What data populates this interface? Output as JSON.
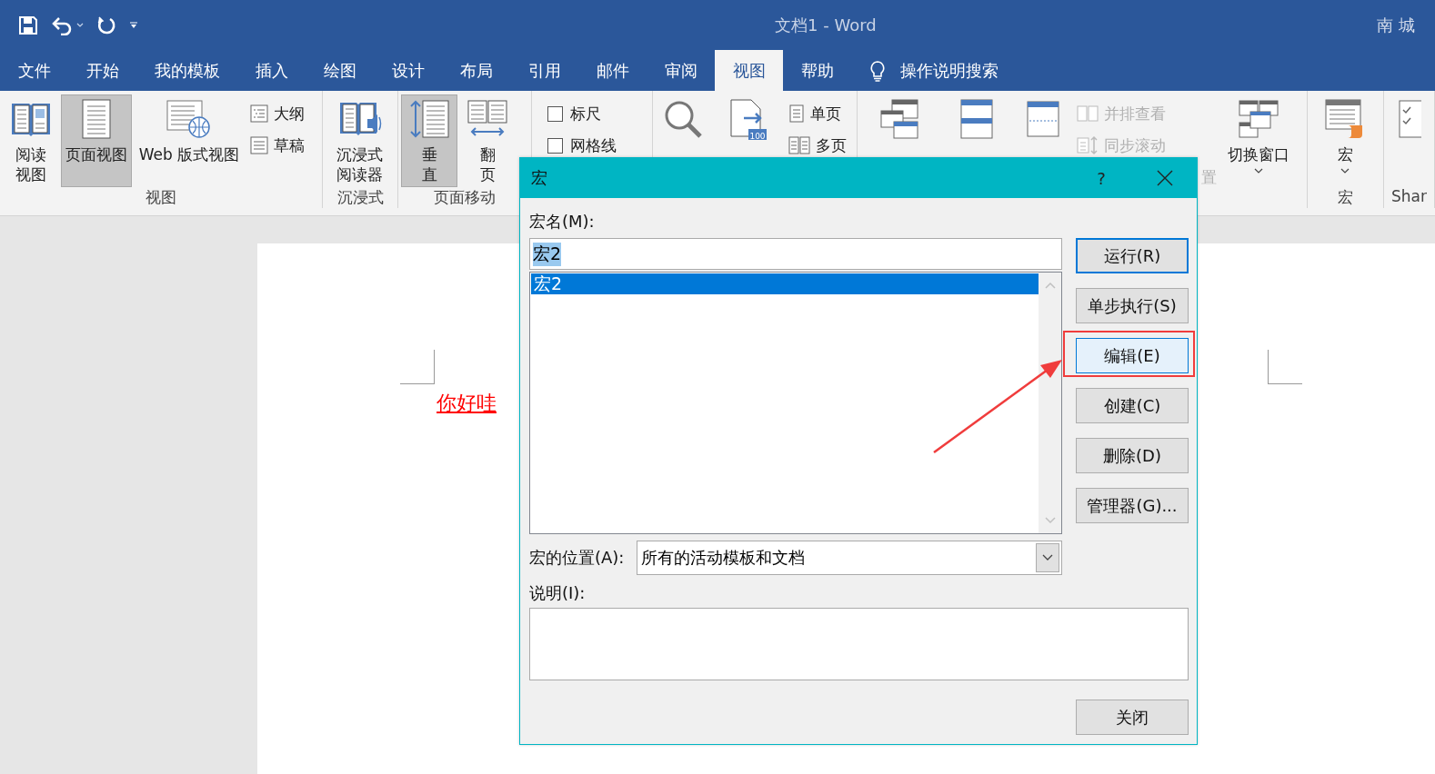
{
  "title_bar": {
    "title": "文档1 - Word",
    "user": "南 城"
  },
  "tabs": [
    {
      "label": "文件",
      "selected": false
    },
    {
      "label": "开始",
      "selected": false
    },
    {
      "label": "我的模板",
      "selected": false
    },
    {
      "label": "插入",
      "selected": false
    },
    {
      "label": "绘图",
      "selected": false
    },
    {
      "label": "设计",
      "selected": false
    },
    {
      "label": "布局",
      "selected": false
    },
    {
      "label": "引用",
      "selected": false
    },
    {
      "label": "邮件",
      "selected": false
    },
    {
      "label": "审阅",
      "selected": false
    },
    {
      "label": "视图",
      "selected": true
    },
    {
      "label": "帮助",
      "selected": false
    }
  ],
  "tell_me": {
    "label": "操作说明搜索"
  },
  "ribbon": [
    {
      "label": "视图",
      "items": [
        {
          "kind": "large",
          "label": "阅读视图",
          "selected": false
        },
        {
          "kind": "large",
          "label": "页面视图",
          "selected": true
        },
        {
          "kind": "large",
          "label": "Web 版式视图",
          "selected": false
        },
        {
          "kind": "stack",
          "items": [
            {
              "kind": "small",
              "label": "大纲",
              "disabled": false
            },
            {
              "kind": "small",
              "label": "草稿",
              "disabled": false
            }
          ]
        }
      ]
    },
    {
      "label": "沉浸式",
      "items": [
        {
          "kind": "large",
          "label": "沉浸式阅读器",
          "selected": false
        }
      ]
    },
    {
      "label": "页面移动",
      "items": [
        {
          "kind": "large",
          "label": "垂直",
          "selected": true
        },
        {
          "kind": "large",
          "label": "翻页",
          "selected": false
        }
      ]
    },
    {
      "items": [
        {
          "kind": "stack",
          "items": [
            {
              "kind": "check",
              "label": "标尺",
              "checked": false
            },
            {
              "kind": "check",
              "label": "网格线",
              "checked": false
            }
          ]
        }
      ]
    },
    {
      "items": [
        {
          "kind": "large",
          "selected": false
        },
        {
          "kind": "large",
          "badge": "100",
          "selected": false
        },
        {
          "kind": "stack",
          "items": [
            {
              "kind": "small",
              "label": "单页",
              "disabled": false
            },
            {
              "kind": "small",
              "label": "多页",
              "disabled": false
            }
          ]
        }
      ]
    },
    {
      "items": [
        {
          "kind": "large",
          "selected": false
        },
        {
          "kind": "large",
          "selected": false
        },
        {
          "kind": "large",
          "selected": false
        },
        {
          "kind": "stack",
          "items": [
            {
              "kind": "small",
              "label": "并排查看",
              "disabled": true
            },
            {
              "kind": "small",
              "label": "同步滚动",
              "disabled": true
            },
            {
              "kind": "small",
              "label": "置",
              "disabled": true
            }
          ]
        },
        {
          "kind": "large",
          "label": "切换窗口",
          "caret": true,
          "selected": false
        }
      ]
    },
    {
      "label": "宏",
      "items": [
        {
          "kind": "large",
          "label": "宏",
          "caret": true,
          "selected": false
        }
      ]
    },
    {
      "label": "Shar",
      "items": [
        {
          "kind": "large",
          "selected": false
        }
      ]
    }
  ],
  "document": {
    "text": "你好哇",
    "color": "#ff0000"
  },
  "dialog": {
    "title": "宏",
    "help": "?",
    "name_label": "宏名(M):",
    "name_value": "宏2",
    "name_text_selected": true,
    "macros": [
      {
        "label": "宏2",
        "selected": true
      }
    ],
    "buttons": [
      {
        "label": "运行(R)",
        "default": true,
        "highlighted": false
      },
      {
        "label": "单步执行(S)",
        "default": false,
        "highlighted": false
      },
      {
        "label": "编辑(E)",
        "default": false,
        "highlighted": true
      },
      {
        "label": "创建(C)",
        "default": false,
        "highlighted": false
      },
      {
        "label": "删除(D)",
        "default": false,
        "highlighted": false
      },
      {
        "label": "管理器(G)...",
        "default": false,
        "highlighted": false
      }
    ],
    "location_label": "宏的位置(A):",
    "location_value": "所有的活动模板和文档",
    "description_label": "说明(I):",
    "close_button": "关闭"
  }
}
